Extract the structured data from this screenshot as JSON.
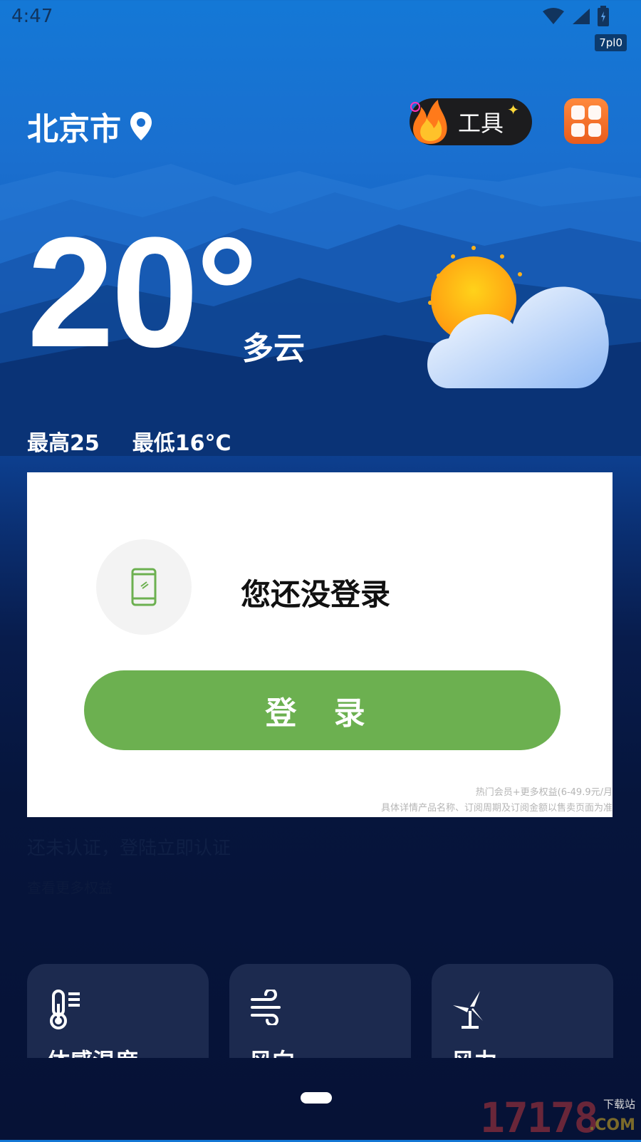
{
  "status_bar": {
    "time": "4:47",
    "badge": "7pl0"
  },
  "header": {
    "city": "北京市",
    "tools_label": "工具"
  },
  "weather": {
    "temperature": "20°",
    "condition": "多云",
    "high": "最高25",
    "low": "最低16°C"
  },
  "login_card": {
    "title": "您还没登录",
    "button_label": "登 录",
    "fine_print_1": "热门会员+更多权益(6-49.9元/月",
    "fine_print_2": "具体详情产品名称、订阅周期及订阅金额以售卖页面为准"
  },
  "hint": {
    "line1": "还未认证，登陆立即认证",
    "line2": "查看更多权益"
  },
  "cards": [
    {
      "label": "体感温度",
      "icon": "thermometer-icon"
    },
    {
      "label": "风向",
      "icon": "wind-icon"
    },
    {
      "label": "风力",
      "icon": "wind-turbine-icon"
    }
  ],
  "watermark": {
    "number": "17178",
    "top": "下载站",
    "suffix": ".COM"
  },
  "colors": {
    "login_green": "#6cb050",
    "card_bg": "#1c2a4f",
    "tools_bg": "#1c1c1e",
    "grid_orange": "#ea5b1b"
  }
}
